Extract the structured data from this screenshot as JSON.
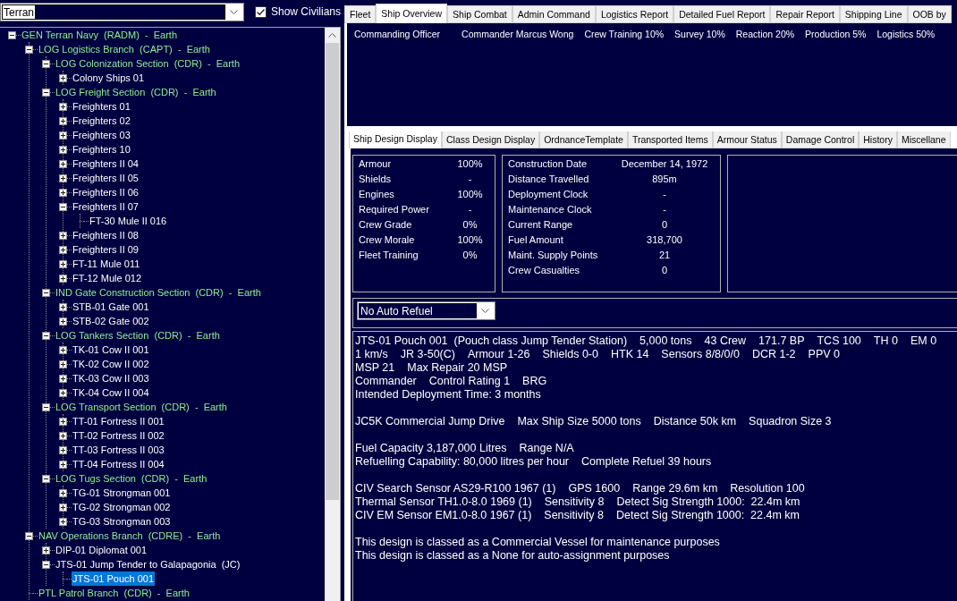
{
  "faction_select": {
    "value": "Terran"
  },
  "show_civilians": {
    "label": "Show Civilians",
    "checked": true
  },
  "tree": {
    "items": [
      {
        "label": "GEN Terran Navy  (RADM)  -  Earth",
        "kind": "formation",
        "expanded": true,
        "selected": false,
        "children": [
          {
            "label": "LOG Logistics Branch  (CAPT)  -  Earth",
            "kind": "formation",
            "expanded": true,
            "selected": false,
            "children": [
              {
                "label": "LOG Colonization Section  (CDR)  -  Earth",
                "kind": "formation",
                "expanded": true,
                "selected": false,
                "children": [
                  {
                    "label": "Colony Ships 01",
                    "kind": "ship",
                    "expanded": false,
                    "selected": false
                  }
                ]
              },
              {
                "label": "LOG Freight Section  (CDR)  -  Earth",
                "kind": "formation",
                "expanded": true,
                "selected": false,
                "children": [
                  {
                    "label": "Freighters 01",
                    "kind": "ship",
                    "expanded": false,
                    "selected": false
                  },
                  {
                    "label": "Freighters 02",
                    "kind": "ship",
                    "expanded": false,
                    "selected": false
                  },
                  {
                    "label": "Freighters 03",
                    "kind": "ship",
                    "expanded": false,
                    "selected": false
                  },
                  {
                    "label": "Freighters 10",
                    "kind": "ship",
                    "expanded": false,
                    "selected": false
                  },
                  {
                    "label": "Freighters II 04",
                    "kind": "ship",
                    "expanded": false,
                    "selected": false
                  },
                  {
                    "label": "Freighters II 05",
                    "kind": "ship",
                    "expanded": false,
                    "selected": false
                  },
                  {
                    "label": "Freighters II 06",
                    "kind": "ship",
                    "expanded": false,
                    "selected": false
                  },
                  {
                    "label": "Freighters II 07",
                    "kind": "ship",
                    "expanded": true,
                    "selected": false,
                    "children": [
                      {
                        "label": "FT-30 Mule II 016",
                        "kind": "ship",
                        "selected": false
                      }
                    ]
                  },
                  {
                    "label": "Freighters II 08",
                    "kind": "ship",
                    "expanded": false,
                    "selected": false
                  },
                  {
                    "label": "Freighters II 09",
                    "kind": "ship",
                    "expanded": false,
                    "selected": false
                  },
                  {
                    "label": "FT-11 Mule 011",
                    "kind": "ship",
                    "expanded": false,
                    "selected": false
                  },
                  {
                    "label": "FT-12 Mule 012",
                    "kind": "ship",
                    "expanded": false,
                    "selected": false
                  }
                ]
              },
              {
                "label": "IND Gate Construction Section  (CDR)  -  Earth",
                "kind": "formation",
                "expanded": true,
                "selected": false,
                "children": [
                  {
                    "label": "STB-01 Gate 001",
                    "kind": "ship",
                    "expanded": false,
                    "selected": false
                  },
                  {
                    "label": "STB-02 Gate 002",
                    "kind": "ship",
                    "expanded": false,
                    "selected": false
                  }
                ]
              },
              {
                "label": "LOG Tankers Section  (CDR)  -  Earth",
                "kind": "formation",
                "expanded": true,
                "selected": false,
                "children": [
                  {
                    "label": "TK-01 Cow II 001",
                    "kind": "ship",
                    "expanded": false,
                    "selected": false
                  },
                  {
                    "label": "TK-02 Cow II 002",
                    "kind": "ship",
                    "expanded": false,
                    "selected": false
                  },
                  {
                    "label": "TK-03 Cow II 003",
                    "kind": "ship",
                    "expanded": false,
                    "selected": false
                  },
                  {
                    "label": "TK-04 Cow II 004",
                    "kind": "ship",
                    "expanded": false,
                    "selected": false
                  }
                ]
              },
              {
                "label": "LOG Transport Section  (CDR)  -  Earth",
                "kind": "formation",
                "expanded": true,
                "selected": false,
                "children": [
                  {
                    "label": "TT-01 Fortress II 001",
                    "kind": "ship",
                    "expanded": false,
                    "selected": false
                  },
                  {
                    "label": "TT-02 Fortress II 002",
                    "kind": "ship",
                    "expanded": false,
                    "selected": false
                  },
                  {
                    "label": "TT-03 Fortress II 003",
                    "kind": "ship",
                    "expanded": false,
                    "selected": false
                  },
                  {
                    "label": "TT-04 Fortress II 004",
                    "kind": "ship",
                    "expanded": false,
                    "selected": false
                  }
                ]
              },
              {
                "label": "LOG Tugs Section  (CDR)  -  Earth",
                "kind": "formation",
                "expanded": true,
                "selected": false,
                "children": [
                  {
                    "label": "TG-01 Strongman 001",
                    "kind": "ship",
                    "expanded": false,
                    "selected": false
                  },
                  {
                    "label": "TG-02 Strongman 002",
                    "kind": "ship",
                    "expanded": false,
                    "selected": false
                  },
                  {
                    "label": "TG-03 Strongman 003",
                    "kind": "ship",
                    "expanded": false,
                    "selected": false
                  }
                ]
              }
            ]
          },
          {
            "label": "NAV Operations Branch  (CDRE)  -  Earth",
            "kind": "formation",
            "expanded": true,
            "selected": false,
            "children": [
              {
                "label": "DIP-01 Diplomat 001",
                "kind": "ship",
                "expanded": false,
                "selected": false
              },
              {
                "label": "JTS-01 Jump Tender to Galapagonia  (JC)",
                "kind": "ship",
                "expanded": true,
                "selected": false,
                "children": [
                  {
                    "label": "JTS-01 Pouch 001",
                    "kind": "ship",
                    "selected": true
                  }
                ]
              }
            ]
          },
          {
            "label": "PTL Patrol Branch  (CDR)  -  Earth",
            "kind": "formation",
            "selected": false
          }
        ]
      }
    ]
  },
  "main_tabs": [
    {
      "label": "Fleet",
      "selected": false
    },
    {
      "label": "Ship Overview",
      "selected": true
    },
    {
      "label": "Ship Combat",
      "selected": false
    },
    {
      "label": "Admin Command",
      "selected": false
    },
    {
      "label": "Logistics Report",
      "selected": false
    },
    {
      "label": "Detailed Fuel Report",
      "selected": false
    },
    {
      "label": "Repair Report",
      "selected": false
    },
    {
      "label": "Shipping Line",
      "selected": false
    },
    {
      "label": "OOB by",
      "selected": false
    }
  ],
  "commanding_officer": {
    "label": "Commanding Officer",
    "name": "Commander Marcus Wong",
    "bonuses": [
      "Crew Training 10%",
      "Survey 10%",
      "Reaction 20%",
      "Production 5%",
      "Logistics 50%"
    ]
  },
  "detail_tabs": [
    {
      "label": "Ship Design Display",
      "selected": true
    },
    {
      "label": "Class Design Display",
      "selected": false
    },
    {
      "label": "OrdnanceTemplate",
      "selected": false
    },
    {
      "label": "Transported Items",
      "selected": false
    },
    {
      "label": "Armour Status",
      "selected": false
    },
    {
      "label": "Damage Control",
      "selected": false
    },
    {
      "label": "History",
      "selected": false
    },
    {
      "label": "Miscellane",
      "selected": false
    }
  ],
  "status": [
    {
      "label": "Armour",
      "value": "100%"
    },
    {
      "label": "Shields",
      "value": "-"
    },
    {
      "label": "Engines",
      "value": "100%"
    },
    {
      "label": "Required Power",
      "value": "-"
    },
    {
      "label": "Crew Grade",
      "value": "0%"
    },
    {
      "label": "Crew Morale",
      "value": "100%"
    },
    {
      "label": "Fleet Training",
      "value": "0%"
    }
  ],
  "service_record": [
    {
      "label": "Construction Date",
      "value": "December 14, 1972"
    },
    {
      "label": "Distance Travelled",
      "value": "895m"
    },
    {
      "label": "Deployment Clock",
      "value": "-"
    },
    {
      "label": "Maintenance Clock",
      "value": "-"
    },
    {
      "label": "Current Range",
      "value": "0"
    },
    {
      "label": "Fuel Amount",
      "value": "318,700"
    },
    {
      "label": "Maint. Supply Points",
      "value": "21"
    },
    {
      "label": "Crew Casualties",
      "value": "0"
    }
  ],
  "refuel_select": {
    "value": "No Auto Refuel"
  },
  "design_summary": {
    "paragraphs": [
      {
        "lines": [
          [
            "JTS-01 Pouch 001  (Pouch class Jump Tender Station)",
            "5,000 tons",
            "43 Crew",
            "171.7 BP",
            "TCS 100",
            "TH 0",
            "EM 0"
          ],
          [
            "1 km/s",
            "JR 3-50(C)",
            "Armour 1-26",
            "Shields 0-0",
            "HTK 14",
            "Sensors 8/8/0/0",
            "DCR 1-2",
            "PPV 0"
          ],
          [
            "MSP 21",
            "Max Repair 20 MSP"
          ],
          [
            "Commander",
            "Control Rating 1",
            "BRG"
          ],
          [
            "Intended Deployment Time: 3 months"
          ]
        ]
      },
      {
        "lines": [
          [
            "JC5K Commercial Jump Drive",
            "Max Ship Size 5000 tons",
            "Distance 50k km",
            "Squadron Size 3"
          ]
        ]
      },
      {
        "lines": [
          [
            "Fuel Capacity 3,187,000 Litres",
            "Range N/A"
          ],
          [
            "Refuelling Capability: 80,000 litres per hour",
            "Complete Refuel 39 hours"
          ]
        ]
      },
      {
        "lines": [
          [
            "CIV Search Sensor AS29-R100 1967 (1)",
            "GPS 1600",
            "Range 29.6m km",
            "Resolution 100"
          ],
          [
            "Thermal Sensor TH1.0-8.0 1969 (1)",
            "Sensitivity 8",
            "Detect Sig Strength 1000:  22.4m km"
          ],
          [
            "CIV EM Sensor EM1.0-8.0 1967 (1)",
            "Sensitivity 8",
            "Detect Sig Strength 1000:  22.4m km"
          ]
        ]
      },
      {
        "lines": [
          [
            "This design is classed as a Commercial Vessel for maintenance purposes"
          ],
          [
            "This design is classed as a None for auto-assignment purposes"
          ]
        ]
      }
    ]
  }
}
